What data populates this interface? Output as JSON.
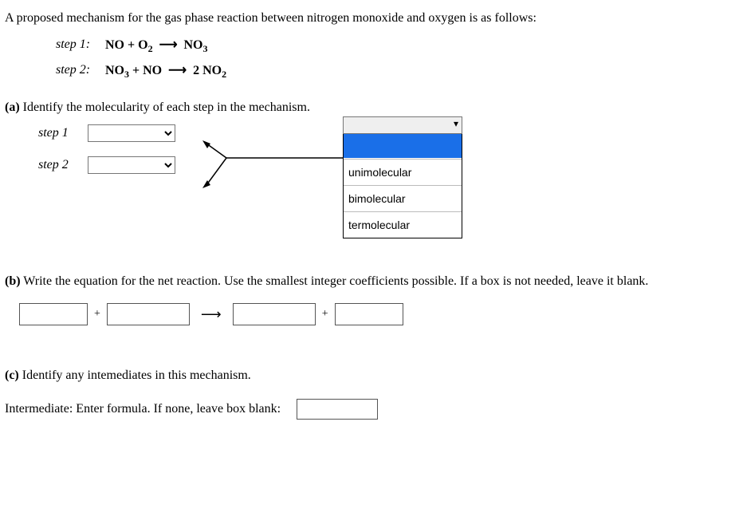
{
  "intro": "A proposed mechanism for the gas phase reaction between nitrogen monoxide and oxygen is as follows:",
  "steps": {
    "s1": {
      "label": "step 1:",
      "reactants": "NO + O",
      "r_sub": "2",
      "arrow": "⟶",
      "products": "NO",
      "p_sub": "3"
    },
    "s2": {
      "label": "step 2:",
      "reactants": "NO",
      "r_sub": "3",
      "plus": " + NO ",
      "arrow": "⟶",
      "coef": "2 ",
      "products": "NO",
      "p_sub": "2"
    }
  },
  "a": {
    "tag": "(a)",
    "prompt": "Identify the molecularity of each step in the mechanism.",
    "row1": "step 1",
    "row2": "step 2",
    "options": {
      "blank": "",
      "o1": "unimolecular",
      "o2": "bimolecular",
      "o3": "termolecular"
    }
  },
  "b": {
    "tag": "(b)",
    "prompt": "Write the equation for the net reaction. Use the smallest integer coefficients possible. If a box is not needed, leave it blank.",
    "plus": "+",
    "arrow": "⟶"
  },
  "c": {
    "tag": "(c)",
    "prompt": "Identify any intemediates in this mechanism.",
    "label": "Intermediate: Enter formula. If none, leave box blank:"
  }
}
